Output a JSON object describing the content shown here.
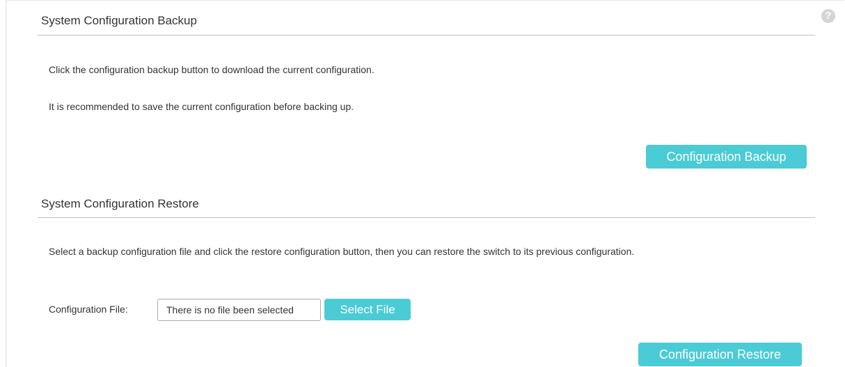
{
  "backup": {
    "title": "System Configuration Backup",
    "desc1": "Click the configuration backup button to download the current configuration.",
    "desc2": "It is recommended to save the current configuration before backing up.",
    "button_label": "Configuration Backup"
  },
  "restore": {
    "title": "System Configuration Restore",
    "desc": "Select a backup configuration file and click the restore configuration button, then you can restore the switch to its previous configuration.",
    "file_label": "Configuration File:",
    "file_value": "There is no file been selected",
    "select_label": "Select File",
    "button_label": "Configuration Restore"
  },
  "help": {
    "symbol": "?"
  },
  "colors": {
    "accent": "#4acbd6",
    "text": "#333333",
    "divider": "#bfbfbf"
  }
}
